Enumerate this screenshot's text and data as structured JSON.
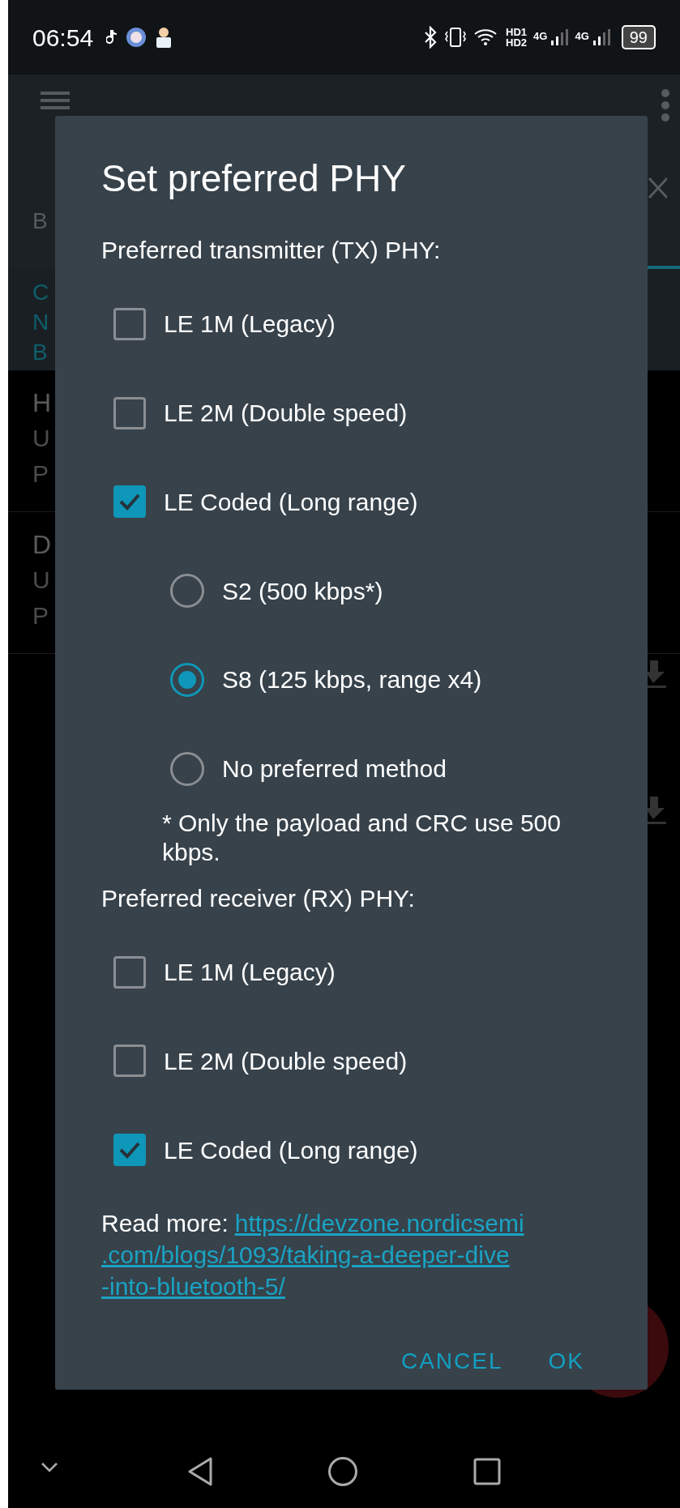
{
  "status_bar": {
    "time": "06:54",
    "network": [
      {
        "label": "HD1"
      },
      {
        "label": "HD2"
      }
    ],
    "signals": [
      {
        "label": "4G"
      },
      {
        "label": "4G"
      }
    ],
    "battery": "99"
  },
  "background": {
    "tab_fragment": "B",
    "info_fragments": [
      "C",
      "N",
      "B"
    ],
    "list_fragments": [
      [
        "H",
        "U",
        "P"
      ],
      [
        "D",
        "U",
        "P"
      ]
    ]
  },
  "dialog": {
    "title": "Set preferred PHY",
    "tx_label": "Preferred transmitter (TX) PHY:",
    "tx_options": [
      {
        "label": "LE 1M (Legacy)",
        "checked": false
      },
      {
        "label": "LE 2M (Double speed)",
        "checked": false
      },
      {
        "label": "LE Coded (Long range)",
        "checked": true
      }
    ],
    "coded_methods": [
      {
        "label": "S2 (500 kbps*)",
        "selected": false
      },
      {
        "label": "S8 (125 kbps, range x4)",
        "selected": true
      },
      {
        "label": "No preferred method",
        "selected": false
      }
    ],
    "footnote": "* Only the payload and CRC use 500 kbps.",
    "rx_label": "Preferred receiver (RX) PHY:",
    "rx_options": [
      {
        "label": "LE 1M (Legacy)",
        "checked": false
      },
      {
        "label": "LE 2M (Double speed)",
        "checked": false
      },
      {
        "label": "LE Coded (Long range)",
        "checked": true
      }
    ],
    "read_more": {
      "prefix": "Read more:",
      "link_lines": [
        "https://devzone.nordicsemi",
        ".com/blogs/1093/taking-a-deeper-dive",
        "-into-bluetooth-5/"
      ]
    },
    "buttons": [
      {
        "label": "CANCEL"
      },
      {
        "label": "OK"
      }
    ]
  }
}
